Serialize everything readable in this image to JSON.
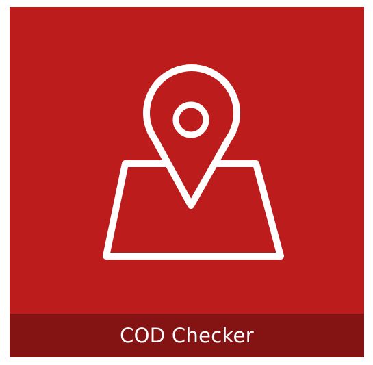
{
  "tile": {
    "label": "COD Checker",
    "icon": "map-location-pin-icon"
  },
  "colors": {
    "tile_background": "#bd1c1c",
    "footer_background": "#841414",
    "icon_stroke": "#ffffff",
    "label_text": "#ffffff",
    "page_background": "#ffffff"
  }
}
